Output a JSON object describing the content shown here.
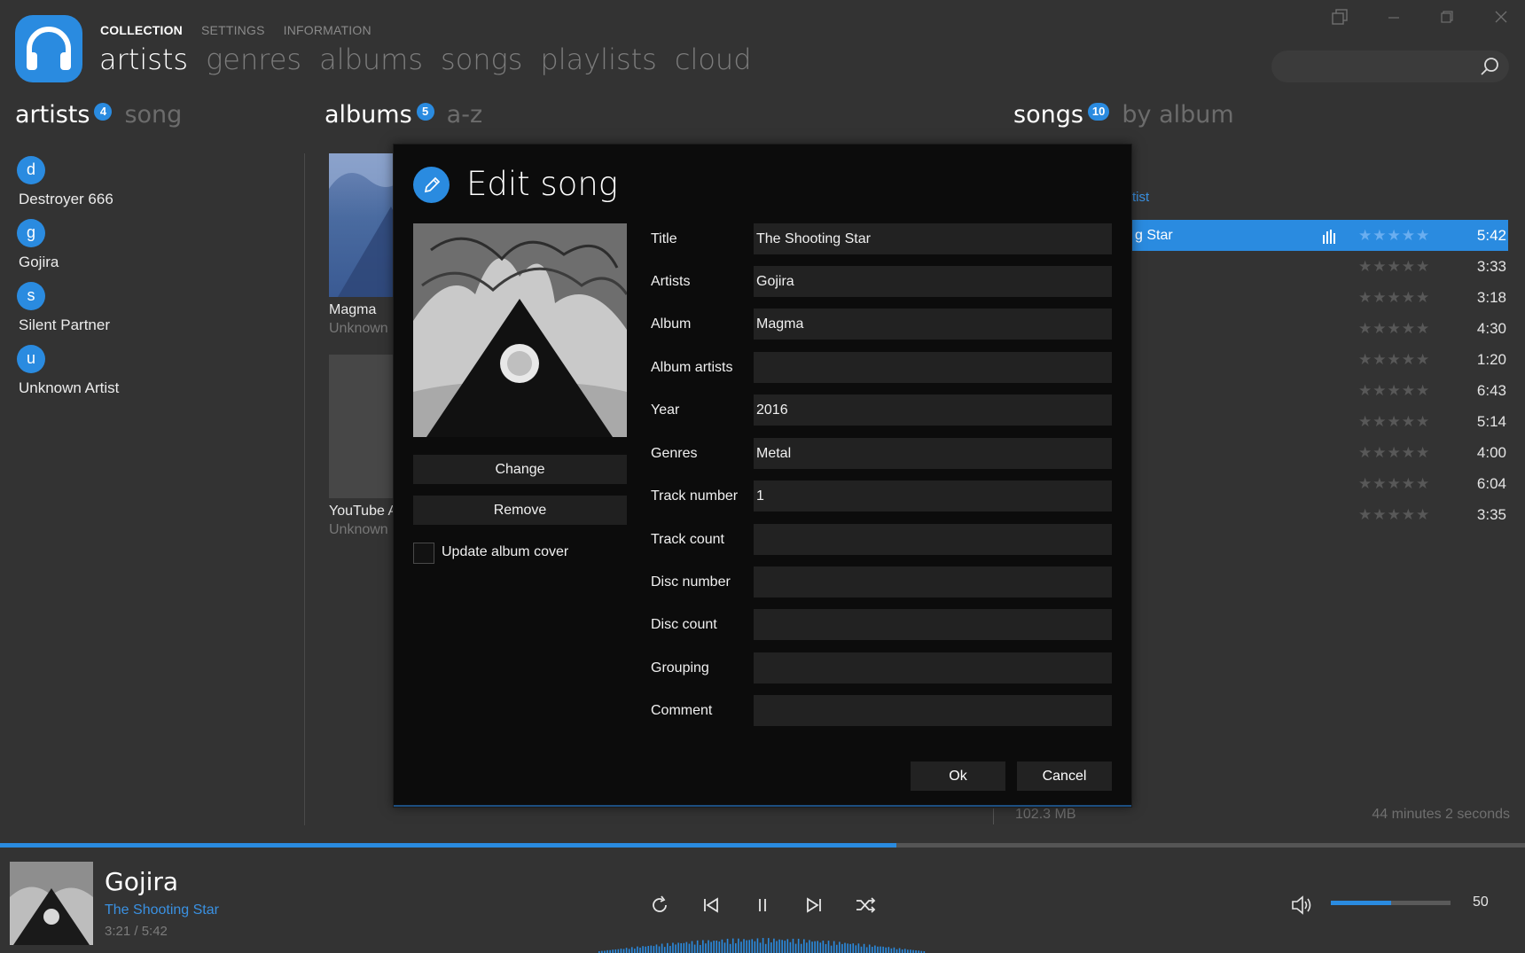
{
  "app": {
    "subnav": [
      "COLLECTION",
      "SETTINGS",
      "INFORMATION"
    ],
    "mainnav": [
      "artists",
      "genres",
      "albums",
      "songs",
      "playlists",
      "cloud"
    ],
    "icons": {
      "logo": "headphones-icon",
      "search": "search-icon",
      "miniplayer": "miniplayer-icon",
      "minimize": "minimize-icon",
      "restore": "restore-icon",
      "close": "close-icon"
    },
    "accent": "#2a8be0"
  },
  "artists": {
    "title": "artists",
    "count": "4",
    "sort": "song",
    "items": [
      {
        "letter": "d",
        "name": "Destroyer 666"
      },
      {
        "letter": "g",
        "name": "Gojira"
      },
      {
        "letter": "s",
        "name": "Silent Partner"
      },
      {
        "letter": "u",
        "name": "Unknown Artist"
      }
    ]
  },
  "albums": {
    "title": "albums",
    "count": "5",
    "sort": "a-z",
    "items": [
      {
        "title": "Magma",
        "artist": "Unknown"
      },
      {
        "title": "YouTube A",
        "artist": "Unknown"
      }
    ]
  },
  "songs": {
    "title": "songs",
    "count": "10",
    "sort": "by album",
    "group_header": "rtist",
    "rows": [
      {
        "name": "g Star",
        "rating": "★★★★★",
        "duration": "5:42"
      },
      {
        "name": "",
        "rating": "★★★★★",
        "duration": "3:33"
      },
      {
        "name": "",
        "rating": "★★★★★",
        "duration": "3:18"
      },
      {
        "name": "",
        "rating": "★★★★★",
        "duration": "4:30"
      },
      {
        "name": "",
        "rating": "★★★★★",
        "duration": "1:20"
      },
      {
        "name": "",
        "rating": "★★★★★",
        "duration": "6:43"
      },
      {
        "name": "",
        "rating": "★★★★★",
        "duration": "5:14"
      },
      {
        "name": "",
        "rating": "★★★★★",
        "duration": "4:00"
      },
      {
        "name": "",
        "rating": "★★★★★",
        "duration": "6:04"
      },
      {
        "name": "",
        "rating": "★★★★★",
        "duration": "3:35"
      }
    ],
    "size": "102.3 MB",
    "total_time": "44 minutes 2 seconds"
  },
  "dialog": {
    "title": "Edit song",
    "change_label": "Change",
    "remove_label": "Remove",
    "update_cover_label": "Update album cover",
    "update_cover_checked": false,
    "fields": {
      "title": {
        "label": "Title",
        "value": "The Shooting Star"
      },
      "artists": {
        "label": "Artists",
        "value": "Gojira"
      },
      "album": {
        "label": "Album",
        "value": "Magma"
      },
      "album_artists": {
        "label": "Album artists",
        "value": ""
      },
      "year": {
        "label": "Year",
        "value": "2016"
      },
      "genres": {
        "label": "Genres",
        "value": "Metal"
      },
      "track_number": {
        "label": "Track number",
        "value": "1"
      },
      "track_count": {
        "label": "Track count",
        "value": ""
      },
      "disc_number": {
        "label": "Disc number",
        "value": ""
      },
      "disc_count": {
        "label": "Disc count",
        "value": ""
      },
      "grouping": {
        "label": "Grouping",
        "value": ""
      },
      "comment": {
        "label": "Comment",
        "value": ""
      }
    },
    "ok_label": "Ok",
    "cancel_label": "Cancel"
  },
  "player": {
    "artist": "Gojira",
    "title": "The Shooting Star",
    "time": "3:21 / 5:42",
    "progress_fraction": 0.588,
    "volume": "50",
    "volume_fraction": 0.5,
    "controls": [
      "repeat-icon",
      "previous-icon",
      "pause-icon",
      "next-icon",
      "shuffle-icon"
    ]
  }
}
